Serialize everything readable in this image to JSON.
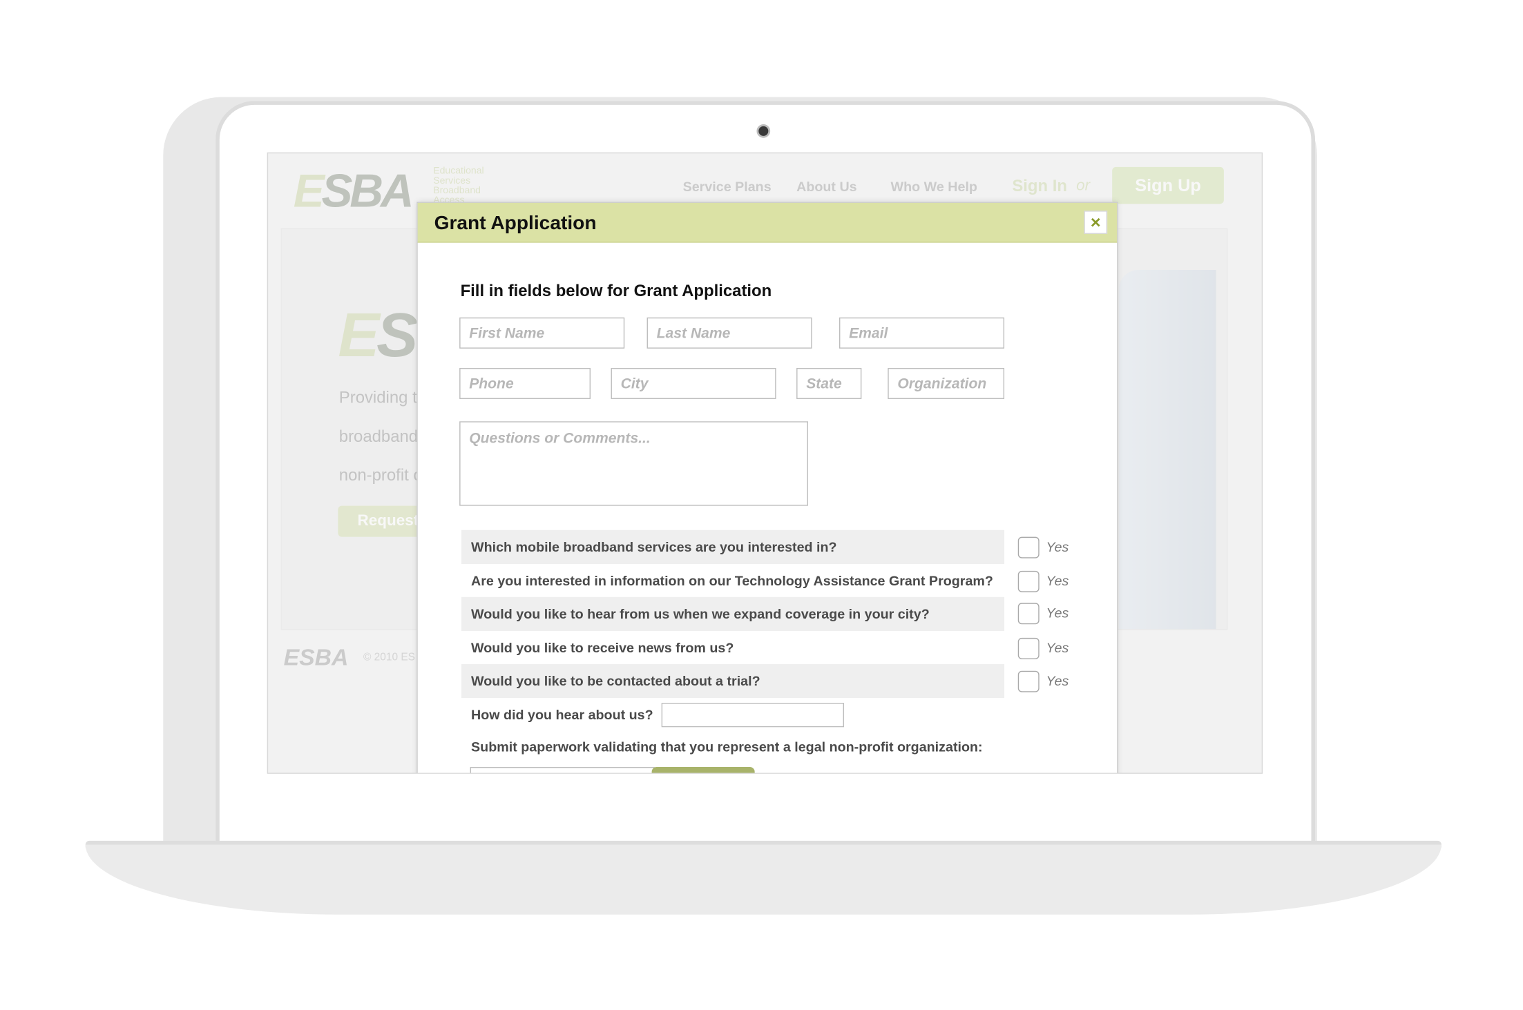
{
  "background_site": {
    "logo": "ESBA",
    "logo_subtitle": "Educational\nServices\nBroadband\nAccess",
    "nav": [
      "Service Plans",
      "About Us",
      "Who We Help"
    ],
    "sign_in": "Sign In",
    "or": "or",
    "sign_up": "Sign Up",
    "hero_text": [
      "Providing t",
      "broadband",
      "non-profit o"
    ],
    "request_button": "Request",
    "footer_logo": "ESBA",
    "footer_copy": "© 2010 ES"
  },
  "modal": {
    "title": "Grant Application",
    "close_label": "×",
    "heading": "Fill in fields below for Grant Application",
    "fields": {
      "first_name": "First Name",
      "last_name": "Last Name",
      "email": "Email",
      "phone": "Phone",
      "city": "City",
      "state": "State",
      "organization": "Organization",
      "comments": "Questions or Comments..."
    },
    "questions": [
      {
        "text": "Which mobile broadband services are you interested in?",
        "option": "Yes",
        "checked": false
      },
      {
        "text": "Are you interested in information on our Technology Assistance Grant Program?",
        "option": "Yes",
        "checked": false
      },
      {
        "text": "Would you like to hear from us when we expand coverage in your city?",
        "option": "Yes",
        "checked": false
      },
      {
        "text": "Would you like to receive news from us?",
        "option": "Yes",
        "checked": false
      },
      {
        "text": "Would you like to be contacted about a trial?",
        "option": "Yes",
        "checked": false
      }
    ],
    "hear_label": "How did you hear about us?",
    "submit_label": "Submit paperwork validating that you represent a legal non-profit organization:"
  },
  "colors": {
    "accent": "#dbe2a5",
    "brand_green": "#a8b36a",
    "close_icon": "#8a9a2a"
  }
}
